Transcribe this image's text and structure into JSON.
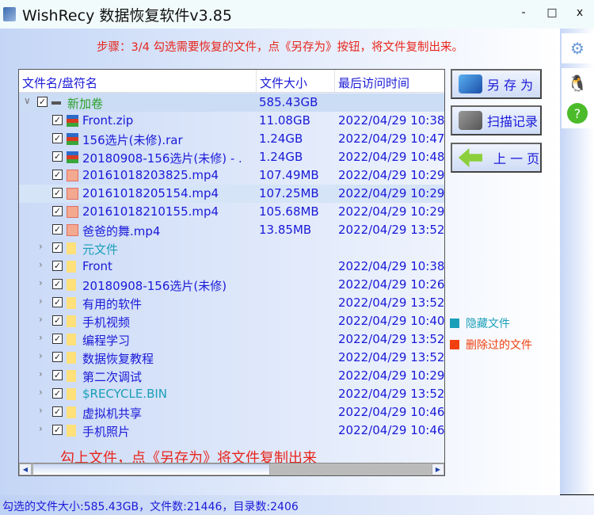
{
  "window": {
    "title": "WishRecy 数据恢复软件v3.85",
    "minimize": "-",
    "maximize": "□",
    "close": "x"
  },
  "step_text": "步骤：3/4 勾选需要恢复的文件，点《另存为》按钮，将文件复制出来。",
  "table": {
    "columns": [
      "文件名/盘符名",
      "文件大小",
      "最后访问时间"
    ],
    "rows": [
      {
        "name": "新加卷",
        "size": "585.43GB",
        "time": "",
        "type": "drive",
        "level": 0,
        "expander": "∨",
        "color": "#2aa02a",
        "state": "selected"
      },
      {
        "name": "Front.zip",
        "size": "11.08GB",
        "time": "2022/04/29 10:38:",
        "type": "zip",
        "level": 1
      },
      {
        "name": "156选片(未修).rar",
        "size": "1.24GB",
        "time": "2022/04/29 10:47:",
        "type": "zip",
        "level": 1
      },
      {
        "name": "20180908-156选片(未修) - ...",
        "size": "1.24GB",
        "time": "2022/04/29 10:48:",
        "type": "zip",
        "level": 1
      },
      {
        "name": "20161018203825.mp4",
        "size": "107.49MB",
        "time": "2022/04/29 10:29:",
        "type": "mp4",
        "level": 1
      },
      {
        "name": "20161018205154.mp4",
        "size": "107.25MB",
        "time": "2022/04/29 10:29:",
        "type": "mp4",
        "level": 1,
        "state": "hover"
      },
      {
        "name": "20161018210155.mp4",
        "size": "105.68MB",
        "time": "2022/04/29 10:29:",
        "type": "mp4",
        "level": 1
      },
      {
        "name": "爸爸的舞.mp4",
        "size": "13.85MB",
        "time": "2022/04/29 13:52:",
        "type": "mp4",
        "level": 1
      },
      {
        "name": "元文件",
        "size": "",
        "time": "",
        "type": "folder",
        "level": 1,
        "expander": "›",
        "color": "#1a9fb8"
      },
      {
        "name": "Front",
        "size": "",
        "time": "2022/04/29 10:38:",
        "type": "folder",
        "level": 1,
        "expander": "›"
      },
      {
        "name": "20180908-156选片(未修)",
        "size": "",
        "time": "2022/04/29 10:26:",
        "type": "folder",
        "level": 1,
        "expander": "›"
      },
      {
        "name": "有用的软件",
        "size": "",
        "time": "2022/04/29 13:52:",
        "type": "folder",
        "level": 1,
        "expander": "›"
      },
      {
        "name": "手机视频",
        "size": "",
        "time": "2022/04/29 10:40:",
        "type": "folder",
        "level": 1,
        "expander": "›"
      },
      {
        "name": "编程学习",
        "size": "",
        "time": "2022/04/29 13:52:",
        "type": "folder",
        "level": 1,
        "expander": "›"
      },
      {
        "name": "数据恢复教程",
        "size": "",
        "time": "2022/04/29 13:52:",
        "type": "folder",
        "level": 1,
        "expander": "›"
      },
      {
        "name": "第二次调试",
        "size": "",
        "time": "2022/04/29 10:29:",
        "type": "folder",
        "level": 1,
        "expander": "›"
      },
      {
        "name": "$RECYCLE.BIN",
        "size": "",
        "time": "2022/04/29 13:52:",
        "type": "folder",
        "level": 1,
        "expander": "›",
        "color": "#1a9fb8"
      },
      {
        "name": "虚拟机共享",
        "size": "",
        "time": "2022/04/29 10:46:",
        "type": "folder",
        "level": 1,
        "expander": "›"
      },
      {
        "name": "手机照片",
        "size": "",
        "time": "2022/04/29 10:46:",
        "type": "folder",
        "level": 1,
        "expander": "›"
      }
    ],
    "checkmark": "✓"
  },
  "overlay_hint": "勾上文件，点《另存为》将文件复制出来",
  "buttons": {
    "save_as": "另 存 为",
    "scan_record": "扫描记录",
    "prev_page": "上 一 页"
  },
  "legend": [
    {
      "label": "隐藏文件",
      "color": "#1a9fb8"
    },
    {
      "label": "删除过的文件",
      "color": "#f04010"
    }
  ],
  "status": "勾选的文件大小:585.43GB，文件数:21446，目录数:2406",
  "scroll": {
    "left": "◀",
    "right": "▶"
  }
}
